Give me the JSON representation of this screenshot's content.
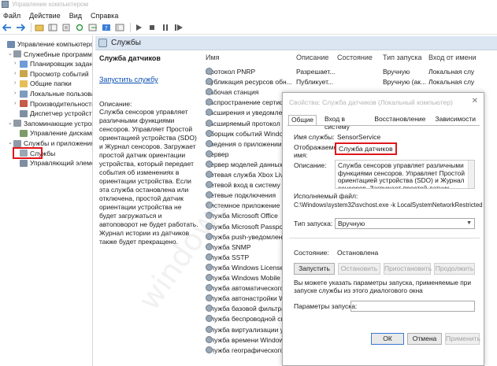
{
  "window": {
    "title": "Управление компьютером"
  },
  "menu": [
    "Файл",
    "Действие",
    "Вид",
    "Справка"
  ],
  "tree": [
    {
      "label": "Управление компьютером (л",
      "level": 0,
      "toggle": "",
      "icon": "computer-icon"
    },
    {
      "label": "Служебные программы",
      "level": 1,
      "toggle": "⌄",
      "icon": "tools-icon"
    },
    {
      "label": "Планировщик задани",
      "level": 2,
      "toggle": "›",
      "icon": "scheduler-icon"
    },
    {
      "label": "Просмотр событий",
      "level": 2,
      "toggle": "›",
      "icon": "event-viewer-icon"
    },
    {
      "label": "Общие папки",
      "level": 2,
      "toggle": "›",
      "icon": "folder-icon"
    },
    {
      "label": "Локальные пользовате",
      "level": 2,
      "toggle": "›",
      "icon": "users-icon"
    },
    {
      "label": "Производительность",
      "level": 2,
      "toggle": "›",
      "icon": "performance-icon"
    },
    {
      "label": "Диспетчер устройств",
      "level": 2,
      "toggle": "",
      "icon": "device-manager-icon"
    },
    {
      "label": "Запоминающие устройст",
      "level": 1,
      "toggle": "⌄",
      "icon": "storage-icon"
    },
    {
      "label": "Управление дисками",
      "level": 2,
      "toggle": "",
      "icon": "disk-icon"
    },
    {
      "label": "Службы и приложения",
      "level": 1,
      "toggle": "⌄",
      "icon": "apps-icon"
    },
    {
      "label": "Службы",
      "level": 2,
      "toggle": "",
      "icon": "services-icon"
    },
    {
      "label": "Управляющий элемен",
      "level": 2,
      "toggle": "",
      "icon": "wmi-icon"
    }
  ],
  "services_header": "Службы",
  "description_pane": {
    "title": "Служба датчиков",
    "start_link": "Запустить службу",
    "desc_label": "Описание:",
    "desc_text": "Служба сенсоров управляет различными функциями сенсоров. Управляет Простой ориентацией устройства (SDO) и Журнал сенсоров. Загружает простой датчик ориентации устройства, который передает события об изменениях в ориентации устройства. Если эта служба остановлена или отключена, простой датчик ориентации устройства не будет загружаться и автоповорот не будет работать. Журнал истории из датчиков также будет прекращено."
  },
  "columns": [
    "Имя",
    "Описание",
    "Состояние",
    "Тип запуска",
    "Вход от имени"
  ],
  "services": [
    {
      "name": "Протокол PNRP",
      "desc": "Разрешает...",
      "state": "",
      "startup": "Вручную",
      "logon": "Локальная слу"
    },
    {
      "name": "Публикация ресурсов обн...",
      "desc": "Публикует...",
      "state": "",
      "startup": "Вручную (ак...",
      "logon": "Локальная слу"
    },
    {
      "name": "Рабочая станция",
      "desc": "",
      "state": "",
      "startup": "",
      "logon": ""
    },
    {
      "name": "Распространение сертиф",
      "desc": "",
      "state": "",
      "startup": "",
      "logon": ""
    },
    {
      "name": "Расширения и уведомлен",
      "desc": "",
      "state": "",
      "startup": "",
      "logon": ""
    },
    {
      "name": "Расширяемый протокол пр",
      "desc": "",
      "state": "",
      "startup": "",
      "logon": ""
    },
    {
      "name": "Сборщик событий Windo",
      "desc": "",
      "state": "",
      "startup": "",
      "logon": ""
    },
    {
      "name": "Сведения о приложении",
      "desc": "",
      "state": "",
      "startup": "",
      "logon": ""
    },
    {
      "name": "Сервер",
      "desc": "",
      "state": "",
      "startup": "",
      "logon": ""
    },
    {
      "name": "Сервер моделей данных",
      "desc": "",
      "state": "",
      "startup": "",
      "logon": ""
    },
    {
      "name": "Сетевая служба Xbox Live",
      "desc": "",
      "state": "",
      "startup": "",
      "logon": ""
    },
    {
      "name": "Сетевой вход в систему",
      "desc": "",
      "state": "",
      "startup": "",
      "logon": ""
    },
    {
      "name": "Сетевые подключения",
      "desc": "",
      "state": "",
      "startup": "",
      "logon": ""
    },
    {
      "name": "Системное приложение CO",
      "desc": "",
      "state": "",
      "startup": "",
      "logon": ""
    },
    {
      "name": "Служба Microsoft Office",
      "desc": "",
      "state": "",
      "startup": "",
      "logon": ""
    },
    {
      "name": "Служба Microsoft Passpo",
      "desc": "",
      "state": "",
      "startup": "",
      "logon": ""
    },
    {
      "name": "Служба push-уведомлени",
      "desc": "",
      "state": "",
      "startup": "",
      "logon": ""
    },
    {
      "name": "Служба SNMP",
      "desc": "",
      "state": "",
      "startup": "",
      "logon": ""
    },
    {
      "name": "Служба SSTP",
      "desc": "",
      "state": "",
      "startup": "",
      "logon": ""
    },
    {
      "name": "Служба Windows License",
      "desc": "",
      "state": "",
      "startup": "",
      "logon": ""
    },
    {
      "name": "Служба Windows Mobile",
      "desc": "",
      "state": "",
      "startup": "",
      "logon": ""
    },
    {
      "name": "Служба автоматического",
      "desc": "",
      "state": "",
      "startup": "",
      "logon": ""
    },
    {
      "name": "Служба автонастройки W",
      "desc": "",
      "state": "",
      "startup": "",
      "logon": ""
    },
    {
      "name": "Служба базовой фильтра",
      "desc": "",
      "state": "",
      "startup": "",
      "logon": ""
    },
    {
      "name": "Служба беспроводной свя",
      "desc": "",
      "state": "",
      "startup": "",
      "logon": ""
    },
    {
      "name": "Служба виртуализации у",
      "desc": "",
      "state": "",
      "startup": "",
      "logon": ""
    },
    {
      "name": "Служба времени Windows",
      "desc": "",
      "state": "",
      "startup": "",
      "logon": ""
    },
    {
      "name": "Служба географического",
      "desc": "",
      "state": "",
      "startup": "",
      "logon": ""
    }
  ],
  "dialog": {
    "title": "Свойства: Служба датчиков (Локальный компьютер)",
    "tabs": [
      "Общие",
      "Вход в систему",
      "Восстановление",
      "Зависимости"
    ],
    "service_name_label": "Имя службы:",
    "service_name": "SensorService",
    "display_name_label": "Отображаемое имя:",
    "display_name": "Служба датчиков",
    "description_label": "Описание:",
    "description": "Служба сенсоров управляет различными функциями сенсоров. Управляет Простой ориентацией устройства (SDO) и Журнал сенсоров. Загружает простой датчик",
    "exe_label": "Исполняемый файл:",
    "exe_path": "C:\\Windows\\system32\\svchost.exe -k LocalSystemNetworkRestricted",
    "startup_label": "Тип запуска:",
    "startup_value": "Вручную",
    "state_label": "Состояние:",
    "state_value": "Остановлена",
    "btn_start": "Запустить",
    "btn_stop": "Остановить",
    "btn_pause": "Приостановить",
    "btn_resume": "Продолжить",
    "note": "Вы можете указать параметры запуска, применяемые при запуске службы из этого диалогового окна",
    "params_label": "Параметры запуска:",
    "btn_ok": "ОК",
    "btn_cancel": "Отмена",
    "btn_apply": "Применить"
  },
  "watermark": "windows"
}
